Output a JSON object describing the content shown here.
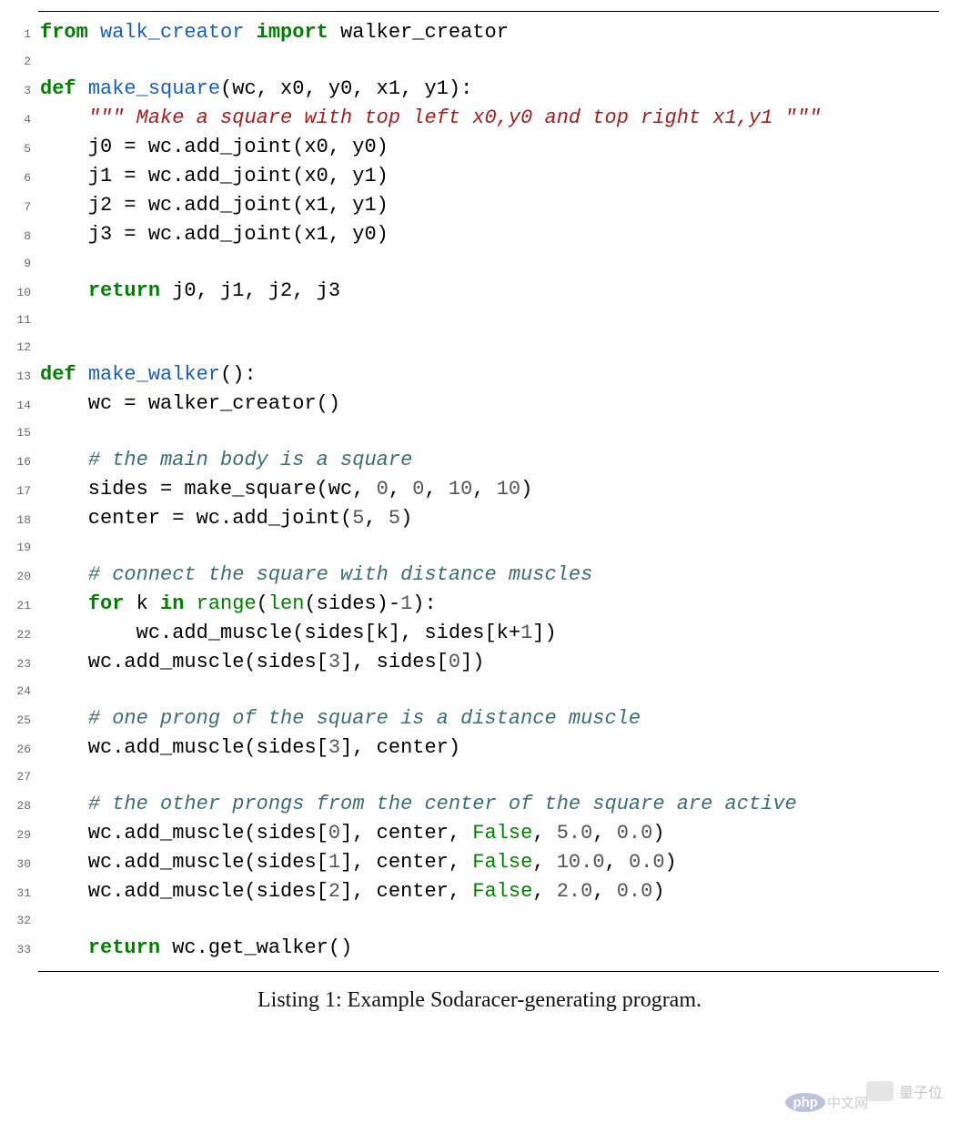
{
  "caption": "Listing 1: Example Sodaracer-generating program.",
  "watermark_text": "量子位",
  "php_badge": {
    "logo": "php",
    "suffix": "中文网"
  },
  "code": {
    "lines": [
      {
        "n": 1,
        "tokens": [
          {
            "t": "from ",
            "c": "kw"
          },
          {
            "t": "walk_creator ",
            "c": "fn"
          },
          {
            "t": "import ",
            "c": "kw"
          },
          {
            "t": "walker_creator",
            "c": ""
          }
        ]
      },
      {
        "n": 2,
        "tokens": []
      },
      {
        "n": 3,
        "tokens": [
          {
            "t": "def ",
            "c": "kw"
          },
          {
            "t": "make_square",
            "c": "fn"
          },
          {
            "t": "(wc, x0, y0, x1, y1):",
            "c": ""
          }
        ]
      },
      {
        "n": 4,
        "tokens": [
          {
            "t": "    ",
            "c": ""
          },
          {
            "t": "\"\"\" Make a square with top left x0,y0 and top right x1,y1 \"\"\"",
            "c": "docstr"
          }
        ]
      },
      {
        "n": 5,
        "tokens": [
          {
            "t": "    j0 = wc.add_joint(x0, y0)",
            "c": ""
          }
        ]
      },
      {
        "n": 6,
        "tokens": [
          {
            "t": "    j1 = wc.add_joint(x0, y1)",
            "c": ""
          }
        ]
      },
      {
        "n": 7,
        "tokens": [
          {
            "t": "    j2 = wc.add_joint(x1, y1)",
            "c": ""
          }
        ]
      },
      {
        "n": 8,
        "tokens": [
          {
            "t": "    j3 = wc.add_joint(x1, y0)",
            "c": ""
          }
        ]
      },
      {
        "n": 9,
        "tokens": []
      },
      {
        "n": 10,
        "tokens": [
          {
            "t": "    ",
            "c": ""
          },
          {
            "t": "return ",
            "c": "kw"
          },
          {
            "t": "j0, j1, j2, j3",
            "c": ""
          }
        ]
      },
      {
        "n": 11,
        "tokens": []
      },
      {
        "n": 12,
        "tokens": []
      },
      {
        "n": 13,
        "tokens": [
          {
            "t": "def ",
            "c": "kw"
          },
          {
            "t": "make_walker",
            "c": "fn"
          },
          {
            "t": "():",
            "c": ""
          }
        ]
      },
      {
        "n": 14,
        "tokens": [
          {
            "t": "    wc = walker_creator()",
            "c": ""
          }
        ]
      },
      {
        "n": 15,
        "tokens": []
      },
      {
        "n": 16,
        "tokens": [
          {
            "t": "    ",
            "c": ""
          },
          {
            "t": "# the main body is a square",
            "c": "comment"
          }
        ]
      },
      {
        "n": 17,
        "tokens": [
          {
            "t": "    sides = make_square(wc, ",
            "c": ""
          },
          {
            "t": "0",
            "c": "num"
          },
          {
            "t": ", ",
            "c": ""
          },
          {
            "t": "0",
            "c": "num"
          },
          {
            "t": ", ",
            "c": ""
          },
          {
            "t": "10",
            "c": "num"
          },
          {
            "t": ", ",
            "c": ""
          },
          {
            "t": "10",
            "c": "num"
          },
          {
            "t": ")",
            "c": ""
          }
        ]
      },
      {
        "n": 18,
        "tokens": [
          {
            "t": "    center = wc.add_joint(",
            "c": ""
          },
          {
            "t": "5",
            "c": "num"
          },
          {
            "t": ", ",
            "c": ""
          },
          {
            "t": "5",
            "c": "num"
          },
          {
            "t": ")",
            "c": ""
          }
        ]
      },
      {
        "n": 19,
        "tokens": []
      },
      {
        "n": 20,
        "tokens": [
          {
            "t": "    ",
            "c": ""
          },
          {
            "t": "# connect the square with distance muscles",
            "c": "comment"
          }
        ]
      },
      {
        "n": 21,
        "tokens": [
          {
            "t": "    ",
            "c": ""
          },
          {
            "t": "for ",
            "c": "kw"
          },
          {
            "t": "k ",
            "c": ""
          },
          {
            "t": "in ",
            "c": "kw"
          },
          {
            "t": "range",
            "c": "builtin"
          },
          {
            "t": "(",
            "c": ""
          },
          {
            "t": "len",
            "c": "builtin"
          },
          {
            "t": "(sides)-",
            "c": ""
          },
          {
            "t": "1",
            "c": "num"
          },
          {
            "t": "):",
            "c": ""
          }
        ]
      },
      {
        "n": 22,
        "tokens": [
          {
            "t": "        wc.add_muscle(sides[k], sides[k+",
            "c": ""
          },
          {
            "t": "1",
            "c": "num"
          },
          {
            "t": "])",
            "c": ""
          }
        ]
      },
      {
        "n": 23,
        "tokens": [
          {
            "t": "    wc.add_muscle(sides[",
            "c": ""
          },
          {
            "t": "3",
            "c": "num"
          },
          {
            "t": "], sides[",
            "c": ""
          },
          {
            "t": "0",
            "c": "num"
          },
          {
            "t": "])",
            "c": ""
          }
        ]
      },
      {
        "n": 24,
        "tokens": []
      },
      {
        "n": 25,
        "tokens": [
          {
            "t": "    ",
            "c": ""
          },
          {
            "t": "# one prong of the square is a distance muscle",
            "c": "comment"
          }
        ]
      },
      {
        "n": 26,
        "tokens": [
          {
            "t": "    wc.add_muscle(sides[",
            "c": ""
          },
          {
            "t": "3",
            "c": "num"
          },
          {
            "t": "], center)",
            "c": ""
          }
        ]
      },
      {
        "n": 27,
        "tokens": []
      },
      {
        "n": 28,
        "tokens": [
          {
            "t": "    ",
            "c": ""
          },
          {
            "t": "# the other prongs from the center of the square are active",
            "c": "comment"
          }
        ]
      },
      {
        "n": 29,
        "tokens": [
          {
            "t": "    wc.add_muscle(sides[",
            "c": ""
          },
          {
            "t": "0",
            "c": "num"
          },
          {
            "t": "], center, ",
            "c": ""
          },
          {
            "t": "False",
            "c": "builtin"
          },
          {
            "t": ", ",
            "c": ""
          },
          {
            "t": "5.0",
            "c": "num"
          },
          {
            "t": ", ",
            "c": ""
          },
          {
            "t": "0.0",
            "c": "num"
          },
          {
            "t": ")",
            "c": ""
          }
        ]
      },
      {
        "n": 30,
        "tokens": [
          {
            "t": "    wc.add_muscle(sides[",
            "c": ""
          },
          {
            "t": "1",
            "c": "num"
          },
          {
            "t": "], center, ",
            "c": ""
          },
          {
            "t": "False",
            "c": "builtin"
          },
          {
            "t": ", ",
            "c": ""
          },
          {
            "t": "10.0",
            "c": "num"
          },
          {
            "t": ", ",
            "c": ""
          },
          {
            "t": "0.0",
            "c": "num"
          },
          {
            "t": ")",
            "c": ""
          }
        ]
      },
      {
        "n": 31,
        "tokens": [
          {
            "t": "    wc.add_muscle(sides[",
            "c": ""
          },
          {
            "t": "2",
            "c": "num"
          },
          {
            "t": "], center, ",
            "c": ""
          },
          {
            "t": "False",
            "c": "builtin"
          },
          {
            "t": ", ",
            "c": ""
          },
          {
            "t": "2.0",
            "c": "num"
          },
          {
            "t": ", ",
            "c": ""
          },
          {
            "t": "0.0",
            "c": "num"
          },
          {
            "t": ")",
            "c": ""
          }
        ]
      },
      {
        "n": 32,
        "tokens": []
      },
      {
        "n": 33,
        "tokens": [
          {
            "t": "    ",
            "c": ""
          },
          {
            "t": "return ",
            "c": "kw"
          },
          {
            "t": "wc.get_walker()",
            "c": ""
          }
        ]
      }
    ]
  }
}
